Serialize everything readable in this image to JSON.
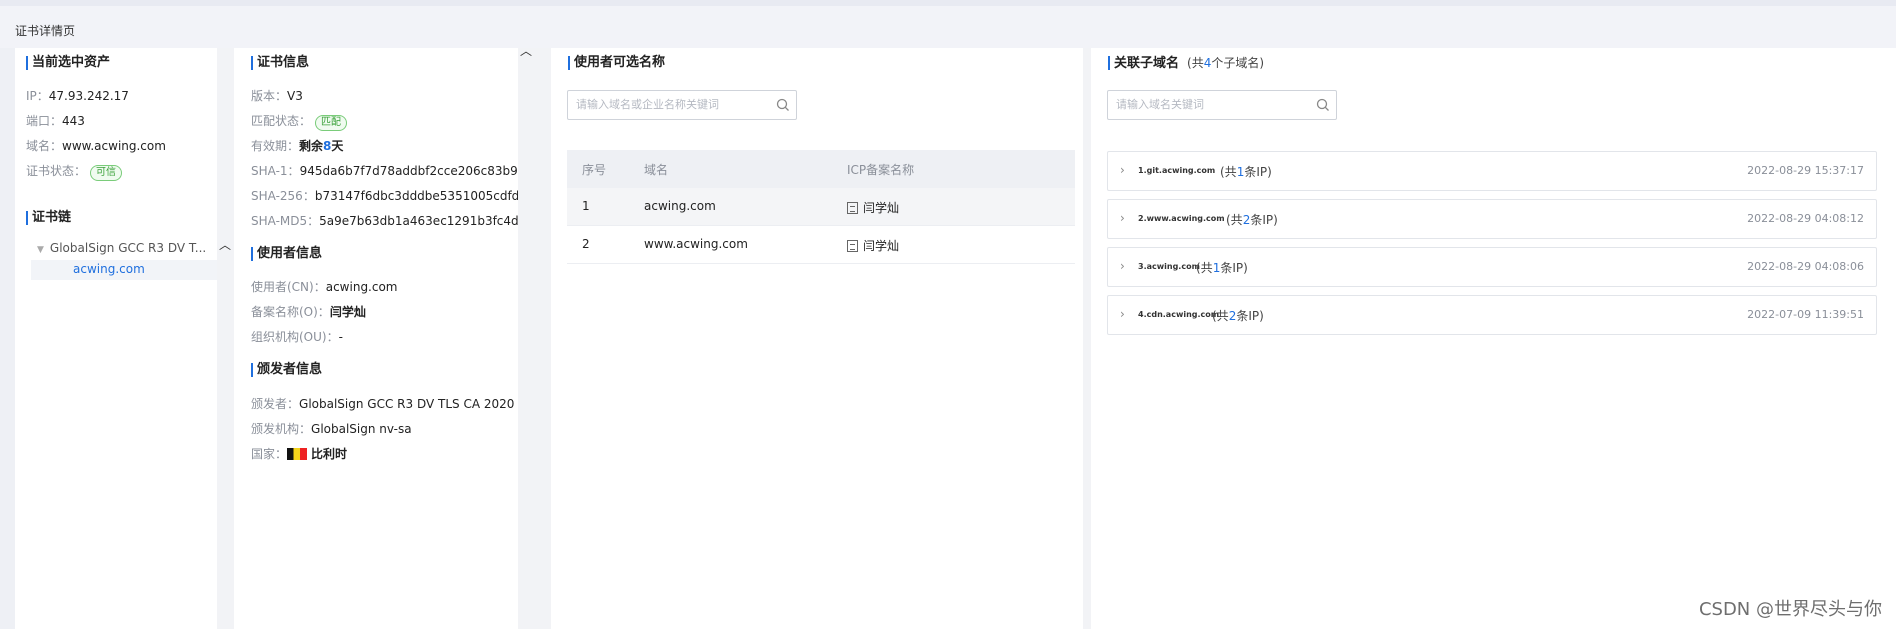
{
  "page": {
    "title": "证书详情页"
  },
  "asset": {
    "title": "当前选中资产",
    "ip_label": "IP：",
    "ip": "47.93.242.17",
    "port_label": "端口：",
    "port": "443",
    "domain_label": "域名：",
    "domain": "www.acwing.com",
    "status_label": "证书状态：",
    "status": "可信"
  },
  "chain": {
    "title": "证书链",
    "root": "GlobalSign GCC R3 DV T...",
    "leaf": "acwing.com"
  },
  "cert": {
    "title": "证书信息",
    "version_label": "版本：",
    "version": "V3",
    "match_label": "匹配状态：",
    "match": "匹配",
    "validity_label": "有效期：",
    "validity_pre": "剩余",
    "validity_days": "8",
    "validity_post": "天",
    "sha1_label": "SHA-1：",
    "sha1": "945da6b7f7d78addbf2cce206c83b9...",
    "sha256_label": "SHA-256：",
    "sha256": "b73147f6dbc3dddbe5351005cdfd...",
    "shamd5_label": "SHA-MD5：",
    "shamd5": "5a9e7b63db1a463ec1291b3fc4d..."
  },
  "user": {
    "title": "使用者信息",
    "cn_label": "使用者(CN)：",
    "cn": "acwing.com",
    "o_label": "备案名称(O)：",
    "o": "闫学灿",
    "ou_label": "组织机构(OU)：",
    "ou": "-"
  },
  "issuer": {
    "title": "颁发者信息",
    "by_label": "颁发者：",
    "by": "GlobalSign GCC R3 DV TLS CA 2020",
    "org_label": "颁发机构：",
    "org": "GlobalSign nv-sa",
    "country_label": "国家：",
    "country": "比利时"
  },
  "names": {
    "title": "使用者可选名称",
    "search_placeholder": "请输入域名或企业名称关键词",
    "columns": [
      "序号",
      "域名",
      "ICP备案名称"
    ],
    "rows": [
      {
        "idx": "1",
        "domain": "acwing.com",
        "icp": "闫学灿"
      },
      {
        "idx": "2",
        "domain": "www.acwing.com",
        "icp": "闫学灿"
      }
    ]
  },
  "subdomains": {
    "title": "关联子域名",
    "sub_pre": "(共",
    "sub_count": "4",
    "sub_post": "个子域名)",
    "search_placeholder": "请输入域名关键词",
    "items": [
      {
        "name": "1.git.acwing.com",
        "pre": "(共",
        "count": "1",
        "post": "条IP)",
        "time": "2022-08-29 15:37:17"
      },
      {
        "name": "2.www.acwing.com",
        "pre": "(共",
        "count": "2",
        "post": "条IP)",
        "time": "2022-08-29 04:08:12"
      },
      {
        "name": "3.acwing.com",
        "pre": "(共",
        "count": "1",
        "post": "条IP)",
        "time": "2022-08-29 04:08:06"
      },
      {
        "name": "4.cdn.acwing.com",
        "pre": "(共",
        "count": "2",
        "post": "条IP)",
        "time": "2022-07-09 11:39:51"
      }
    ]
  },
  "watermark": "CSDN @世界尽头与你",
  "colors": {
    "accent": "#1f6fde",
    "trusted": "#3aa13a"
  }
}
